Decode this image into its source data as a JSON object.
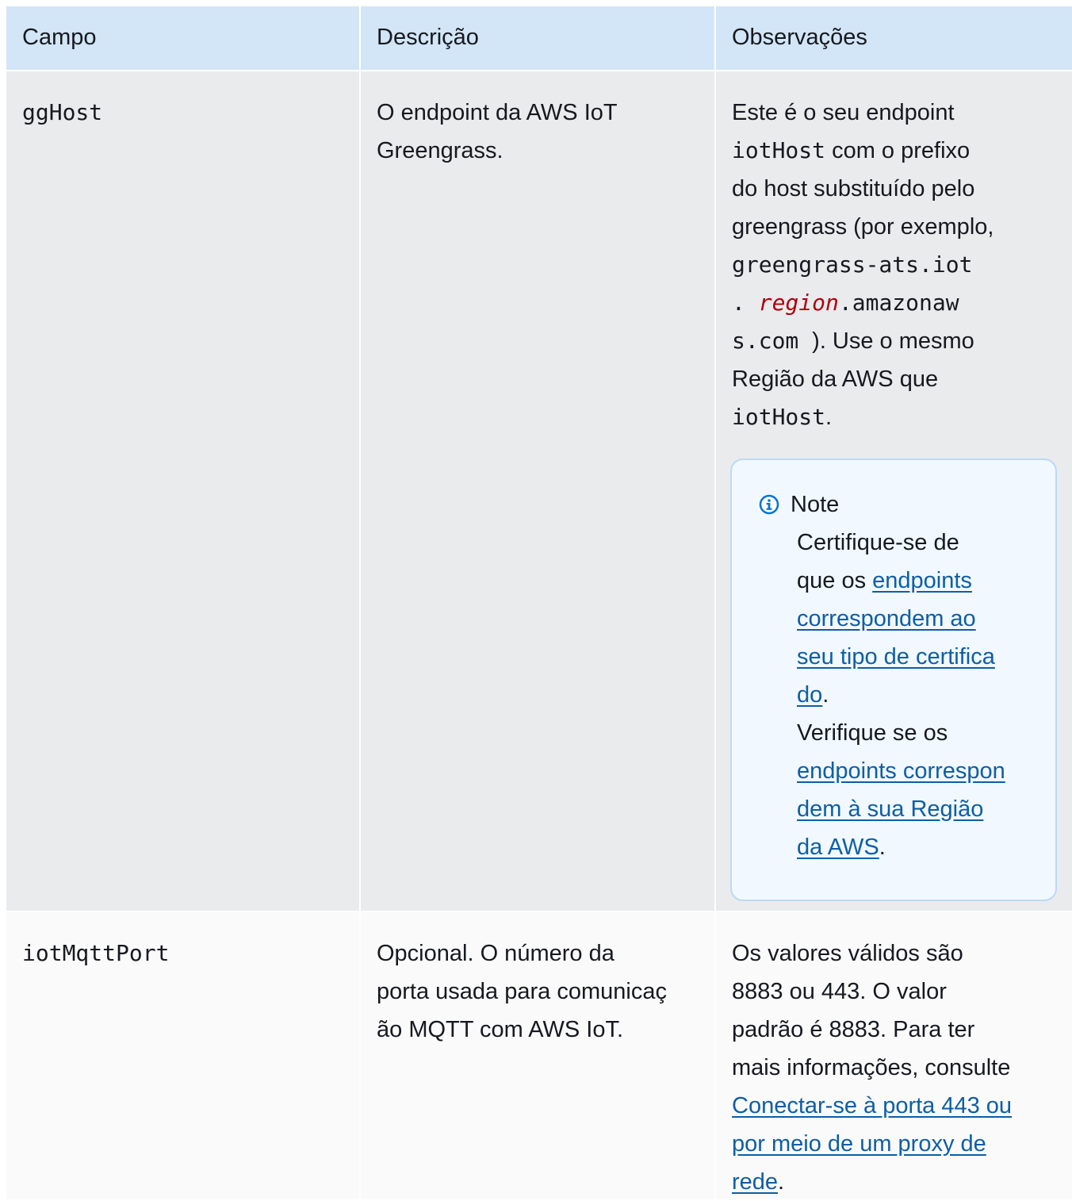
{
  "table": {
    "headers": [
      "Campo",
      "Descrição",
      "Observações"
    ],
    "rows": [
      {
        "field": "ggHost",
        "description_lines": [
          "O endpoint da AWS IoT",
          "Greengrass."
        ],
        "notes": {
          "l1": "Este é o seu endpoint",
          "l2_code": "iotHost",
          "l2_text": " com o prefixo",
          "l3": "do host substituído pelo",
          "l4": "greengrass (por exemplo,",
          "l5_code": "greengrass-ats.iot",
          "l6_dot": ". ",
          "l6_param": "region",
          "l6_code": ".amazonaw",
          "l7_code": "s.com ",
          "l7_text": "). Use o mesmo",
          "l8": "Região da AWS que",
          "l9_code": "iotHost",
          "l9_text": "."
        },
        "note_box": {
          "icon": "info-icon",
          "title": "Note",
          "p1_l1": "Certifique-se de",
          "p1_l2_text": "que os ",
          "p1_link_l1": "endpoints",
          "p1_link_l2": "correspondem ao",
          "p1_link_l3": "seu tipo de certifica",
          "p1_link_l4": "do",
          "p1_end": ".",
          "p2_l1": "Verifique se os",
          "p2_link_l1": "endpoints correspon",
          "p2_link_l2": "dem à sua Região",
          "p2_link_l3": "da AWS",
          "p2_end": "."
        }
      },
      {
        "field": "iotMqttPort",
        "description_lines": [
          "Opcional. O número da",
          "porta usada para comunicaç",
          "ão MQTT com AWS IoT."
        ],
        "notes": {
          "l1": "Os valores válidos são",
          "l2": "8883 ou 443. O valor",
          "l3": "padrão é 8883. Para ter",
          "l4": "mais informações, consulte",
          "link_l1": "Conectar-se à porta 443 ou",
          "link_l2": "por meio de um proxy de",
          "link_l3": "rede",
          "end": "."
        }
      }
    ]
  },
  "colors": {
    "header_bg": "#d3e6f7",
    "row1_bg": "#e9ebed",
    "row2_bg": "#fafafa",
    "link": "#0e5ea4",
    "param": "#b0000e",
    "note_bg": "#f1f8ff",
    "note_border": "#bcd9f5",
    "info_icon": "#0972d3"
  }
}
